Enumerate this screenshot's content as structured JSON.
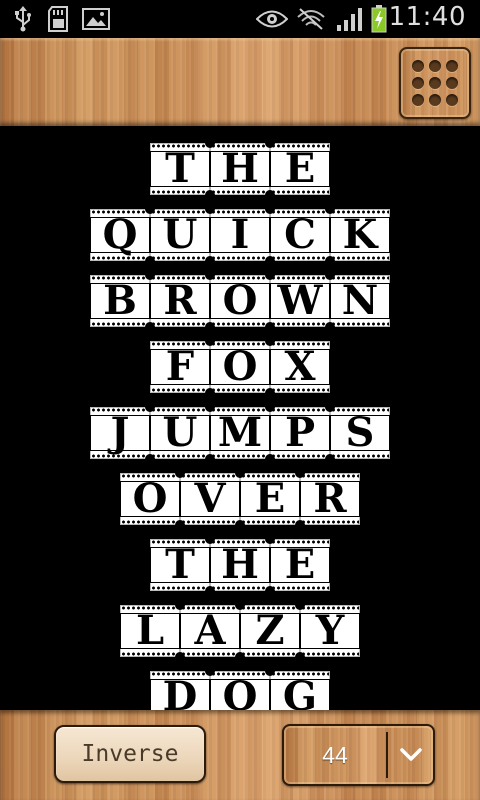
{
  "status_bar": {
    "time": "11:40",
    "icons": [
      "usb-icon",
      "sd-card-icon",
      "gallery-icon",
      "eye-icon",
      "signal-muted-icon",
      "cell-signal-icon",
      "battery-charging-icon"
    ]
  },
  "toolbar": {
    "menu_icon": "grid-menu-icon"
  },
  "film_text": {
    "lines": [
      "THE",
      "QUICK",
      "BROWN",
      "FOX",
      "JUMPS",
      "OVER",
      "THE",
      "LAZY",
      "DOG"
    ]
  },
  "bottom_bar": {
    "inverse_label": "Inverse",
    "size_value": "44",
    "dropdown_icon": "chevron-down-icon"
  },
  "colors": {
    "background": "#000000",
    "wood": "#c88c55",
    "film_frame": "#ffffff",
    "letter": "#000000"
  }
}
